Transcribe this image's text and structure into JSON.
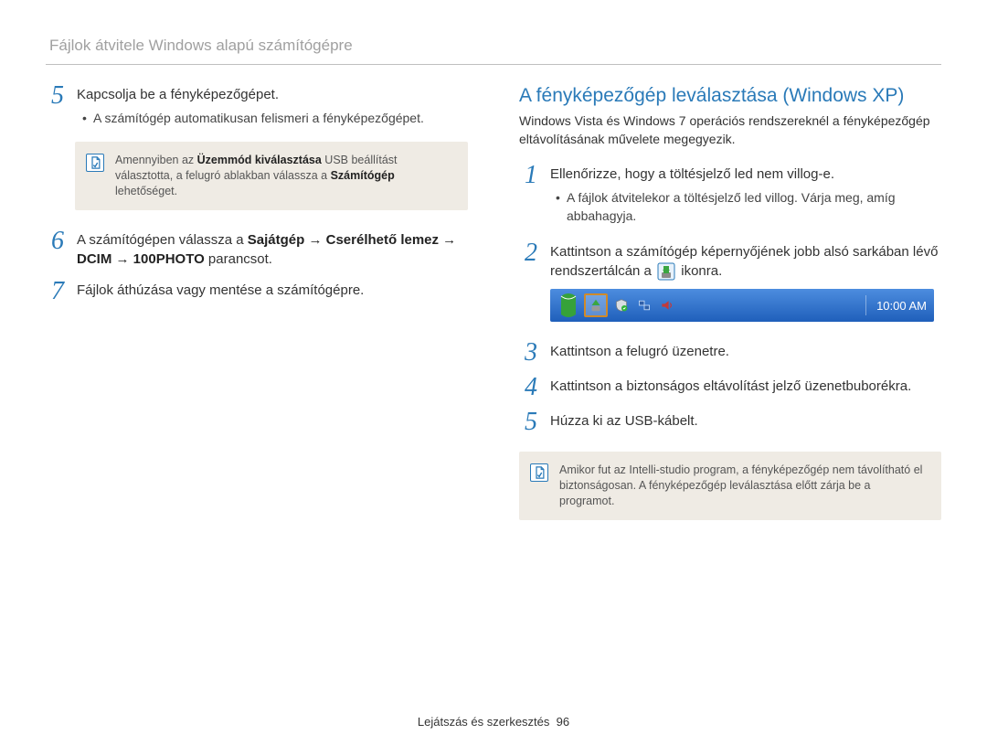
{
  "header": {
    "title": "Fájlok átvitele Windows alapú számítógépre"
  },
  "left": {
    "steps": [
      {
        "num": "5",
        "text": "Kapcsolja be a fényképezőgépet.",
        "bullets": [
          "A számítógép automatikusan felismeri a fényképezőgépet."
        ]
      },
      {
        "num": "6",
        "prefix": "A számítógépen válassza a ",
        "bold_run": "Sajátgép → Cserélhető lemez → DCIM → 100PHOTO",
        "suffix": " parancsot."
      },
      {
        "num": "7",
        "text": "Fájlok áthúzása vagy mentése a számítógépre."
      }
    ],
    "note": {
      "pre": "Amennyiben az ",
      "bold1": "Üzemmód kiválasztása",
      "mid": " USB beállítást választotta, a felugró ablakban válassza a ",
      "bold2": "Számítógép",
      "post": " lehetőséget."
    }
  },
  "right": {
    "heading": "A fényképezőgép leválasztása (Windows XP)",
    "intro": "Windows Vista és Windows 7 operációs rendszereknél a fényképezőgép eltávolításának művelete megegyezik.",
    "steps": [
      {
        "num": "1",
        "text": "Ellenőrizze, hogy a töltésjelző led nem villog-e.",
        "bullets": [
          "A fájlok átvitelekor a töltésjelző led villog. Várja meg, amíg abbahagyja."
        ]
      },
      {
        "num": "2",
        "pre": "Kattintson a számítógép képernyőjének jobb alsó sarkában lévő rendszertálcán a ",
        "post": " ikonra."
      },
      {
        "num": "3",
        "text": "Kattintson a felugró üzenetre."
      },
      {
        "num": "4",
        "text": "Kattintson a biztonságos eltávolítást jelző üzenetbuborékra."
      },
      {
        "num": "5",
        "text": "Húzza ki az USB-kábelt."
      }
    ],
    "note": "Amikor fut az Intelli-studio program, a fényképezőgép nem távolítható el biztonságosan. A fényképezőgép leválasztása előtt zárja be a programot.",
    "taskbar": {
      "clock": "10:00 AM"
    }
  },
  "footer": {
    "section": "Lejátszás és szerkesztés",
    "page": "96"
  }
}
